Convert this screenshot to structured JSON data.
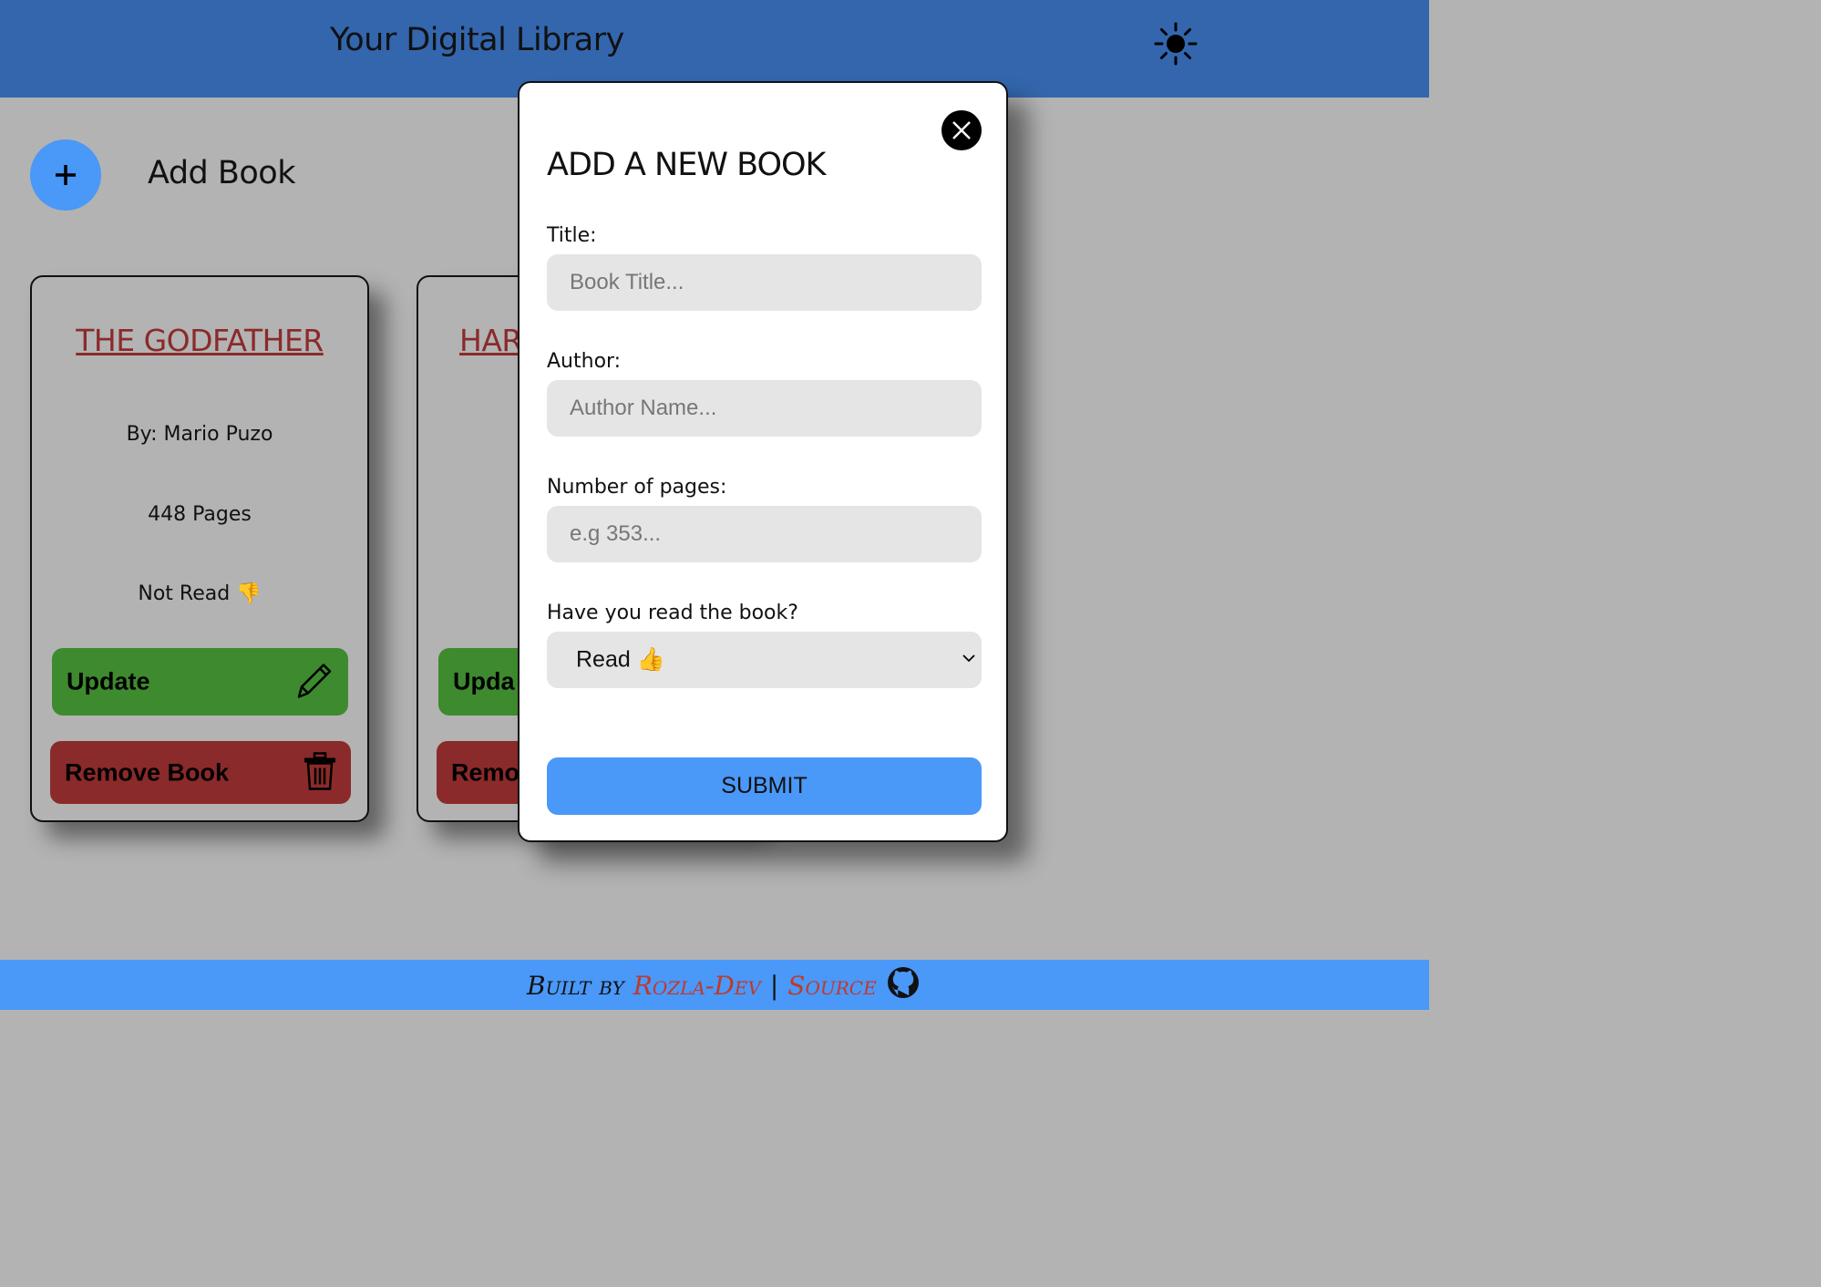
{
  "header": {
    "title": "Your Digital Library"
  },
  "toolbar": {
    "add_icon": "+",
    "add_label": "Add Book"
  },
  "books": [
    {
      "title": "THE GODFATHER",
      "author": "By: Mario Puzo",
      "pages": "448 Pages",
      "status": "Not Read 👎",
      "update_label": "Update",
      "remove_label": "Remove Book"
    },
    {
      "title": "HAR",
      "update_label": "Upda",
      "remove_label": "Remo"
    }
  ],
  "modal": {
    "heading": "ADD A NEW BOOK",
    "title_label": "Title:",
    "title_placeholder": "Book Title...",
    "author_label": "Author:",
    "author_placeholder": "Author Name...",
    "pages_label": "Number of pages:",
    "pages_placeholder": "e.g 353...",
    "read_label": "Have you read the book?",
    "read_value": "Read 👍",
    "submit_label": "SUBMIT"
  },
  "footer": {
    "built_by": "Built by",
    "author": "Rozla-Dev",
    "separator": "|",
    "source": "Source"
  },
  "colors": {
    "header_bg": "#3366ad",
    "page_bg": "#b3b3b3",
    "accent_blue": "#4a98f7",
    "update_green": "#3e8a2e",
    "remove_red": "#8b2a2a"
  },
  "icons": [
    "sun-icon",
    "plus-icon",
    "pencil-icon",
    "trash-icon",
    "close-icon",
    "chevron-down-icon",
    "github-icon"
  ]
}
